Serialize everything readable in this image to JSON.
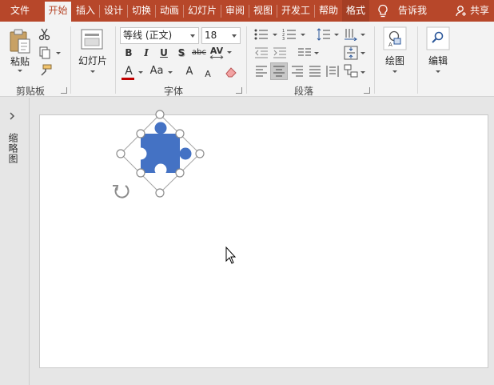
{
  "tabs": [
    "文件",
    "开始",
    "插入",
    "设计",
    "切换",
    "动画",
    "幻灯片",
    "审阅",
    "视图",
    "开发工",
    "帮助",
    "格式"
  ],
  "tell_me": "告诉我",
  "share": "共享",
  "clipboard": {
    "paste": "粘贴",
    "group": "剪贴板"
  },
  "slides": {
    "new_slide": "幻灯片",
    "group": ""
  },
  "font": {
    "name": "等线 (正文)",
    "size": "18",
    "group": "字体",
    "bold": "B",
    "italic": "I",
    "underline": "U",
    "shadow": "S",
    "strike": "abc",
    "spacing": "AV",
    "color_letter": "A",
    "case": "Aa",
    "grow": "A",
    "shrink": "A"
  },
  "paragraph": {
    "group": "段落"
  },
  "drawing": {
    "label": "绘图"
  },
  "editing": {
    "label": "编辑"
  },
  "side_panel": {
    "label": "缩略图"
  },
  "colors": {
    "accent": "#b7472a",
    "shape_fill": "#4472c4",
    "font_color_bar": "#c00000"
  }
}
